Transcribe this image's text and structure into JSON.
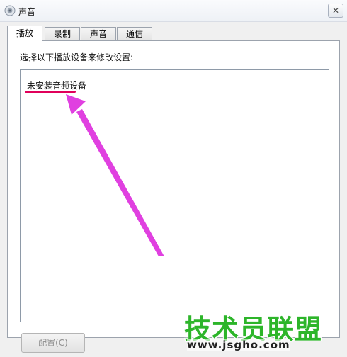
{
  "window": {
    "title": "声音",
    "close_glyph": "✕",
    "icon": "speaker-icon"
  },
  "tabs": [
    {
      "label": "播放",
      "active": true
    },
    {
      "label": "录制",
      "active": false
    },
    {
      "label": "声音",
      "active": false
    },
    {
      "label": "通信",
      "active": false
    }
  ],
  "playback": {
    "instruction": "选择以下播放设备来修改设置:",
    "empty_message": "未安装音频设备"
  },
  "buttons": {
    "configure": "配置(C)"
  },
  "annotation": {
    "arrow_color": "#e040e0",
    "underline_color": "#e0005a"
  },
  "watermark": {
    "title": "技术员联盟",
    "url": "www.jsgho.com",
    "color": "#2db52a"
  }
}
